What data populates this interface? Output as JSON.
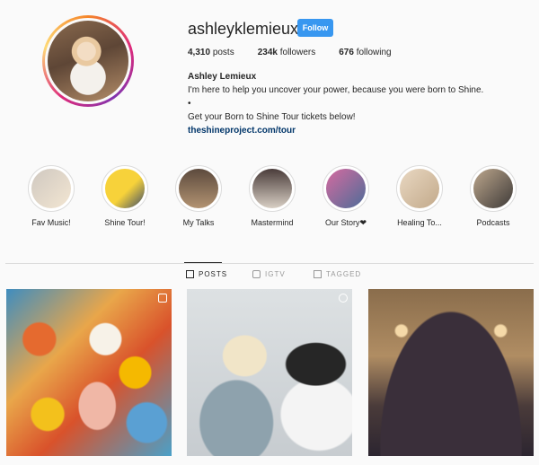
{
  "profile": {
    "username": "ashleyklemieux",
    "follow_label": "Follow",
    "stats": {
      "posts_num": "4,310",
      "posts_label": "posts",
      "followers_num": "234k",
      "followers_label": "followers",
      "following_num": "676",
      "following_label": "following"
    },
    "bio": {
      "name": "Ashley Lemieux",
      "line1": "I'm here to help you uncover your power, because you were born to Shine.",
      "line2": "•",
      "line3": "Get your Born to Shine Tour tickets below!",
      "link": "theshineproject.com/tour"
    }
  },
  "highlights": [
    {
      "label": "Fav Music!",
      "colors": [
        "#cfc8c0",
        "#f3e6d2"
      ]
    },
    {
      "label": "Shine Tour!",
      "colors": [
        "#f7d23a",
        "#3b4b6a"
      ]
    },
    {
      "label": "My Talks",
      "colors": [
        "#5c4a3d",
        "#b39372"
      ]
    },
    {
      "label": "Mastermind",
      "colors": [
        "#4a3c3a",
        "#d8cfc4"
      ]
    },
    {
      "label": "Our Story❤",
      "colors": [
        "#d66ba0",
        "#4d6c98"
      ]
    },
    {
      "label": "Healing To...",
      "colors": [
        "#e9d8c2",
        "#c2a98a"
      ]
    },
    {
      "label": "Podcasts",
      "colors": [
        "#bda78d",
        "#3e3a38"
      ]
    }
  ],
  "tabs": [
    {
      "label": "POSTS",
      "active": true
    },
    {
      "label": "IGTV",
      "active": false
    },
    {
      "label": "TAGGED",
      "active": false
    }
  ],
  "colors": {
    "accent": "#3897f0",
    "link": "#003569"
  }
}
